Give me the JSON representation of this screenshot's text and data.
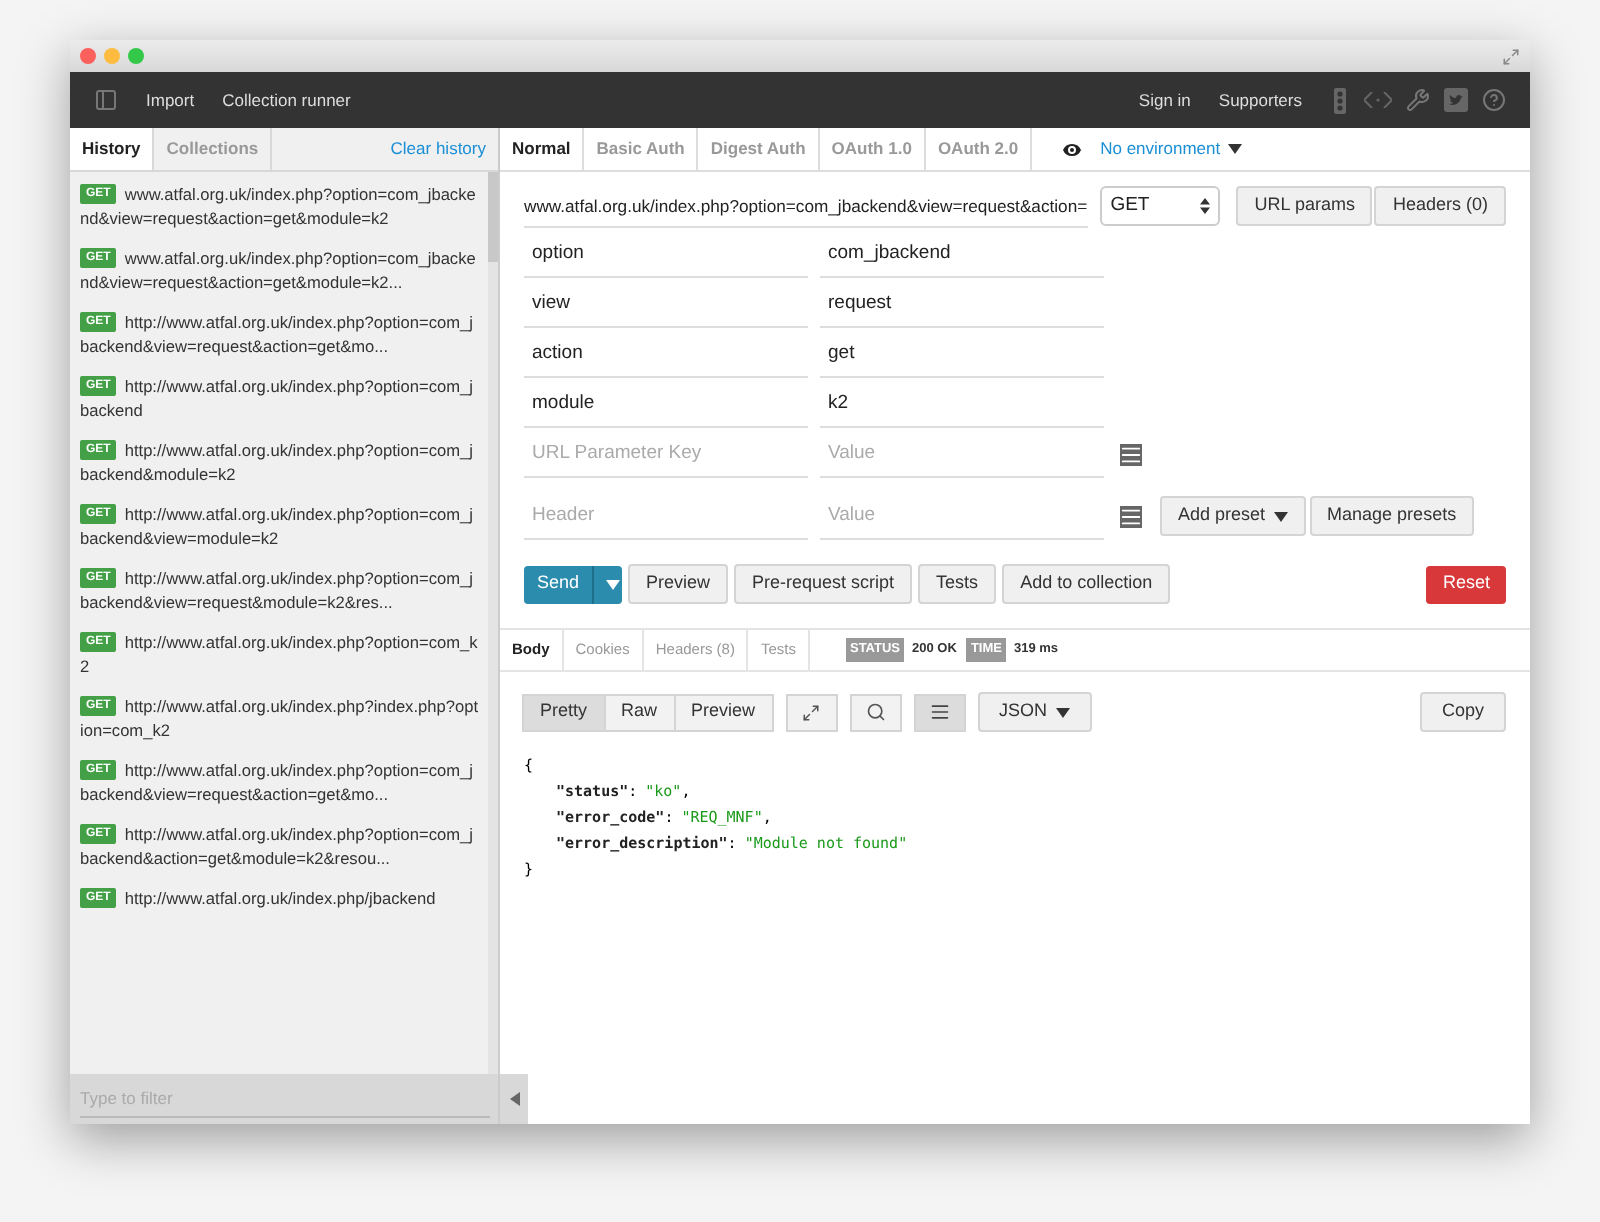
{
  "toolbar": {
    "left_items": [
      "Import",
      "Collection runner"
    ],
    "right_items": [
      "Sign in",
      "Supporters"
    ]
  },
  "sidebar": {
    "tabs": [
      {
        "label": "History",
        "selected": true
      },
      {
        "label": "Collections",
        "selected": false
      }
    ],
    "clear_link": "Clear history",
    "items": [
      {
        "method": "GET",
        "url": "www.atfal.org.uk/index.php?option=com_jbackend&view=request&action=get&module=k2"
      },
      {
        "method": "GET",
        "url": "www.atfal.org.uk/index.php?option=com_jbackend&view=request&action=get&module=k2..."
      },
      {
        "method": "GET",
        "url": "http://www.atfal.org.uk/index.php?option=com_jbackend&view=request&action=get&mo..."
      },
      {
        "method": "GET",
        "url": "http://www.atfal.org.uk/index.php?option=com_jbackend"
      },
      {
        "method": "GET",
        "url": "http://www.atfal.org.uk/index.php?option=com_jbackend&module=k2"
      },
      {
        "method": "GET",
        "url": "http://www.atfal.org.uk/index.php?option=com_jbackend&view=module=k2"
      },
      {
        "method": "GET",
        "url": "http://www.atfal.org.uk/index.php?option=com_jbackend&view=request&module=k2&res..."
      },
      {
        "method": "GET",
        "url": "http://www.atfal.org.uk/index.php?option=com_k2"
      },
      {
        "method": "GET",
        "url": "http://www.atfal.org.uk/index.php?index.php?option=com_k2"
      },
      {
        "method": "GET",
        "url": "http://www.atfal.org.uk/index.php?option=com_jbackend&view=request&action=get&mo..."
      },
      {
        "method": "GET",
        "url": "http://www.atfal.org.uk/index.php?option=com_jbackend&action=get&module=k2&resou..."
      },
      {
        "method": "GET",
        "url": "http://www.atfal.org.uk/index.php/jbackend"
      }
    ],
    "filter": {
      "placeholder": "Type to filter"
    }
  },
  "auth_tabs": [
    {
      "label": "Normal",
      "selected": true
    },
    {
      "label": "Basic Auth",
      "selected": false
    },
    {
      "label": "Digest Auth",
      "selected": false
    },
    {
      "label": "OAuth 1.0",
      "selected": false
    },
    {
      "label": "OAuth 2.0",
      "selected": false
    }
  ],
  "environment": "No environment",
  "request": {
    "url": "www.atfal.org.uk/index.php?option=com_jbackend&view=request&action=",
    "method": "GET",
    "url_params_button": "URL params",
    "headers_button": "Headers (0)",
    "params": [
      {
        "key": "option",
        "value": "com_jbackend"
      },
      {
        "key": "view",
        "value": "request"
      },
      {
        "key": "action",
        "value": "get"
      },
      {
        "key": "module",
        "value": "k2"
      }
    ],
    "new_param": {
      "key_placeholder": "URL Parameter Key",
      "value_placeholder": "Value"
    },
    "new_header": {
      "key_placeholder": "Header",
      "value_placeholder": "Value"
    },
    "add_preset": "Add preset",
    "manage_presets": "Manage presets",
    "send": "Send",
    "actions": [
      "Preview",
      "Pre-request script",
      "Tests",
      "Add to collection"
    ],
    "reset": "Reset"
  },
  "response": {
    "tabs": [
      {
        "label": "Body",
        "selected": true
      },
      {
        "label": "Cookies",
        "selected": false
      },
      {
        "label": "Headers (8)",
        "selected": false
      },
      {
        "label": "Tests",
        "selected": false
      }
    ],
    "status_label": "STATUS",
    "status": "200 OK",
    "time_label": "TIME",
    "time": "319 ms",
    "view_modes": [
      {
        "label": "Pretty",
        "selected": true
      },
      {
        "label": "Raw",
        "selected": false
      },
      {
        "label": "Preview",
        "selected": false
      }
    ],
    "format": "JSON",
    "copy": "Copy",
    "body": {
      "open": "{",
      "close": "}",
      "lines": [
        {
          "key": "\"status\"",
          "value": "\"ko\"",
          "sep": ",",
          "colon": ":"
        },
        {
          "key": "\"error_code\"",
          "value": "\"REQ_MNF\"",
          "sep": ",",
          "colon": ":"
        },
        {
          "key": "\"error_description\"",
          "value": "\"Module not found\"",
          "colon": ":"
        }
      ]
    }
  }
}
